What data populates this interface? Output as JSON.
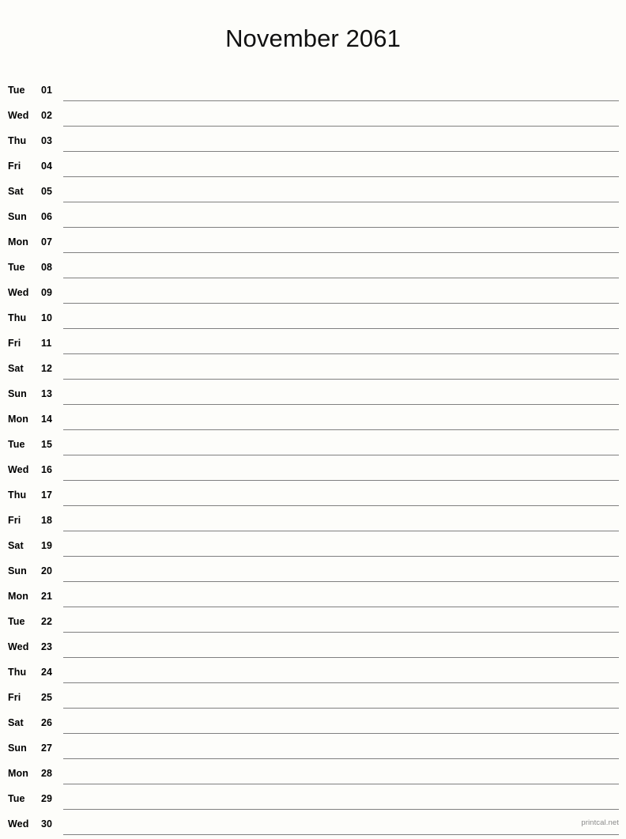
{
  "page": {
    "background_color": "#fdfdfa",
    "text_color": "#000000",
    "rule_color": "#808080",
    "footer_color": "#8a8a8a"
  },
  "header": {
    "title": "November 2061",
    "month": "November",
    "year": "2061"
  },
  "calendar": {
    "layout": "single-column-notes",
    "days": [
      {
        "weekday": "Tue",
        "date": "01"
      },
      {
        "weekday": "Wed",
        "date": "02"
      },
      {
        "weekday": "Thu",
        "date": "03"
      },
      {
        "weekday": "Fri",
        "date": "04"
      },
      {
        "weekday": "Sat",
        "date": "05"
      },
      {
        "weekday": "Sun",
        "date": "06"
      },
      {
        "weekday": "Mon",
        "date": "07"
      },
      {
        "weekday": "Tue",
        "date": "08"
      },
      {
        "weekday": "Wed",
        "date": "09"
      },
      {
        "weekday": "Thu",
        "date": "10"
      },
      {
        "weekday": "Fri",
        "date": "11"
      },
      {
        "weekday": "Sat",
        "date": "12"
      },
      {
        "weekday": "Sun",
        "date": "13"
      },
      {
        "weekday": "Mon",
        "date": "14"
      },
      {
        "weekday": "Tue",
        "date": "15"
      },
      {
        "weekday": "Wed",
        "date": "16"
      },
      {
        "weekday": "Thu",
        "date": "17"
      },
      {
        "weekday": "Fri",
        "date": "18"
      },
      {
        "weekday": "Sat",
        "date": "19"
      },
      {
        "weekday": "Sun",
        "date": "20"
      },
      {
        "weekday": "Mon",
        "date": "21"
      },
      {
        "weekday": "Tue",
        "date": "22"
      },
      {
        "weekday": "Wed",
        "date": "23"
      },
      {
        "weekday": "Thu",
        "date": "24"
      },
      {
        "weekday": "Fri",
        "date": "25"
      },
      {
        "weekday": "Sat",
        "date": "26"
      },
      {
        "weekday": "Sun",
        "date": "27"
      },
      {
        "weekday": "Mon",
        "date": "28"
      },
      {
        "weekday": "Tue",
        "date": "29"
      },
      {
        "weekday": "Wed",
        "date": "30"
      }
    ]
  },
  "footer": {
    "credit": "printcal.net"
  }
}
